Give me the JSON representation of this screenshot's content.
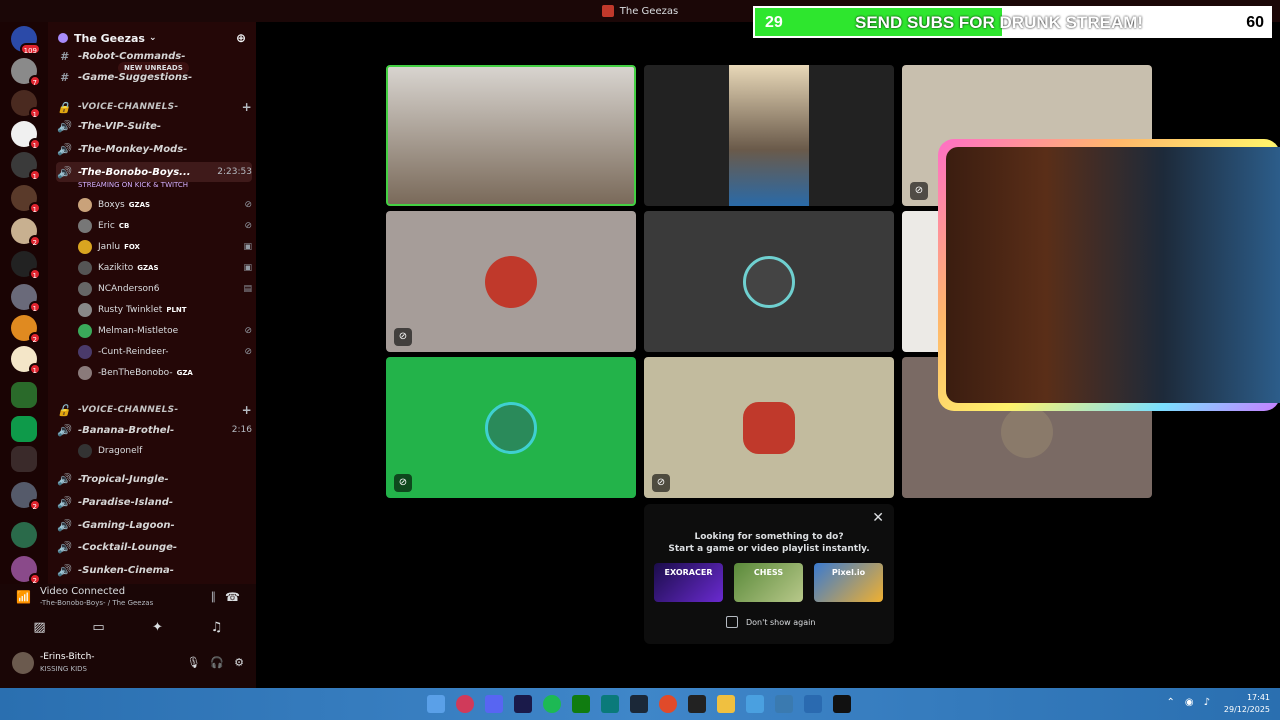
{
  "window": {
    "title": "The Geezas"
  },
  "server": {
    "name": "The Geezas"
  },
  "channels": {
    "new_unreads": "NEW UNREADS",
    "top_items": [
      "-Robot-Commands-",
      "-Game-Suggestions-"
    ],
    "voice_cat_1": "-VOICE-CHANNELS-",
    "vip": "-The-VIP-Suite-",
    "monkey": "-The-Monkey-Mods-",
    "bonobo": "-The-Bonobo-Boys...",
    "bonobo_timer": "2:23:53",
    "streaming": "STREAMING ON KICK & TWITCH",
    "members": [
      {
        "name": "Boxys",
        "tag": "GZAS"
      },
      {
        "name": "Eric",
        "tag": "CB"
      },
      {
        "name": "Janlu",
        "tag": "FOX"
      },
      {
        "name": "Kazikito",
        "tag": "GZAS"
      },
      {
        "name": "NCAnderson6",
        "tag": ""
      },
      {
        "name": "Rusty Twinklet",
        "tag": "PLNT"
      },
      {
        "name": "Melman-Mistletoe",
        "tag": ""
      },
      {
        "name": "-Cunt-Reindeer-",
        "tag": ""
      },
      {
        "name": "-BenTheBonobo-",
        "tag": "GZA"
      }
    ],
    "voice_cat_2": "-VOICE-CHANNELS-",
    "banana": "-Banana-Brothel-",
    "banana_timer": "2:16",
    "banana_member": "Dragonelf",
    "tropical": "-Tropical-Jungle-",
    "paradise": "-Paradise-Island-",
    "gaming": "-Gaming-Lagoon-",
    "cocktail": "-Cocktail-Lounge-",
    "sunken": "-Sunken-Cinema-"
  },
  "voice": {
    "status": "Video Connected",
    "location": "-The-Bonobo-Boys- / The Geezas"
  },
  "me": {
    "name": "-Erins-Bitch-",
    "status": "KISSING KIDS"
  },
  "activity": {
    "line1": "Looking for something to do?",
    "line2": "Start a game or video playlist instantly.",
    "games": [
      "EXORACER",
      "CHESS",
      "Pixel.io"
    ],
    "dont_show": "Don't show again"
  },
  "subs": {
    "current": "29",
    "message": "SEND SUBS FOR DRUNK STREAM!",
    "goal": "60",
    "progress": 0.48
  },
  "clock": {
    "time": "17:41",
    "date": "29/12/2025"
  },
  "badges": [
    "109",
    "7",
    "1",
    "1",
    "1",
    "1",
    "2",
    "1",
    "1",
    "2",
    "1",
    "2",
    "2"
  ],
  "colors": {
    "accent_green": "#2ee62e",
    "tile_green": "#23a55a",
    "rail": "#1a0404"
  }
}
